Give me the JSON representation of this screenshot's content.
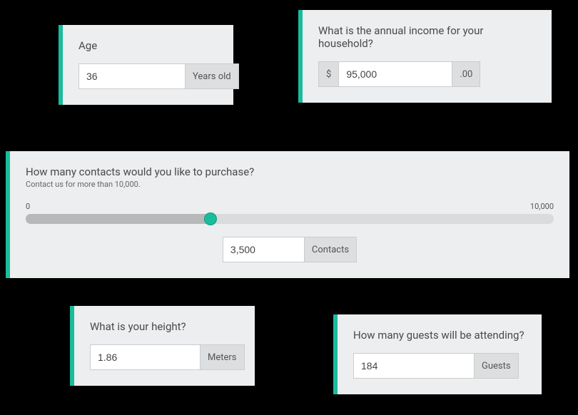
{
  "age": {
    "label": "Age",
    "value": "36",
    "unit": "Years old"
  },
  "income": {
    "label": "What is the annual income for your household?",
    "currency_symbol": "$",
    "value": "95,000",
    "decimal_suffix": ".00"
  },
  "contacts": {
    "label": "How many contacts would you like to purchase?",
    "sublabel": "Contact us for more than 10,000.",
    "min_label": "0",
    "max_label": "10,000",
    "min": 0,
    "max": 10000,
    "value_num": 3500,
    "value": "3,500",
    "unit": "Contacts"
  },
  "height": {
    "label": "What is your height?",
    "value": "1.86",
    "unit": "Meters"
  },
  "guests": {
    "label": "How many guests will be attending?",
    "value": "184",
    "unit": "Guests"
  }
}
